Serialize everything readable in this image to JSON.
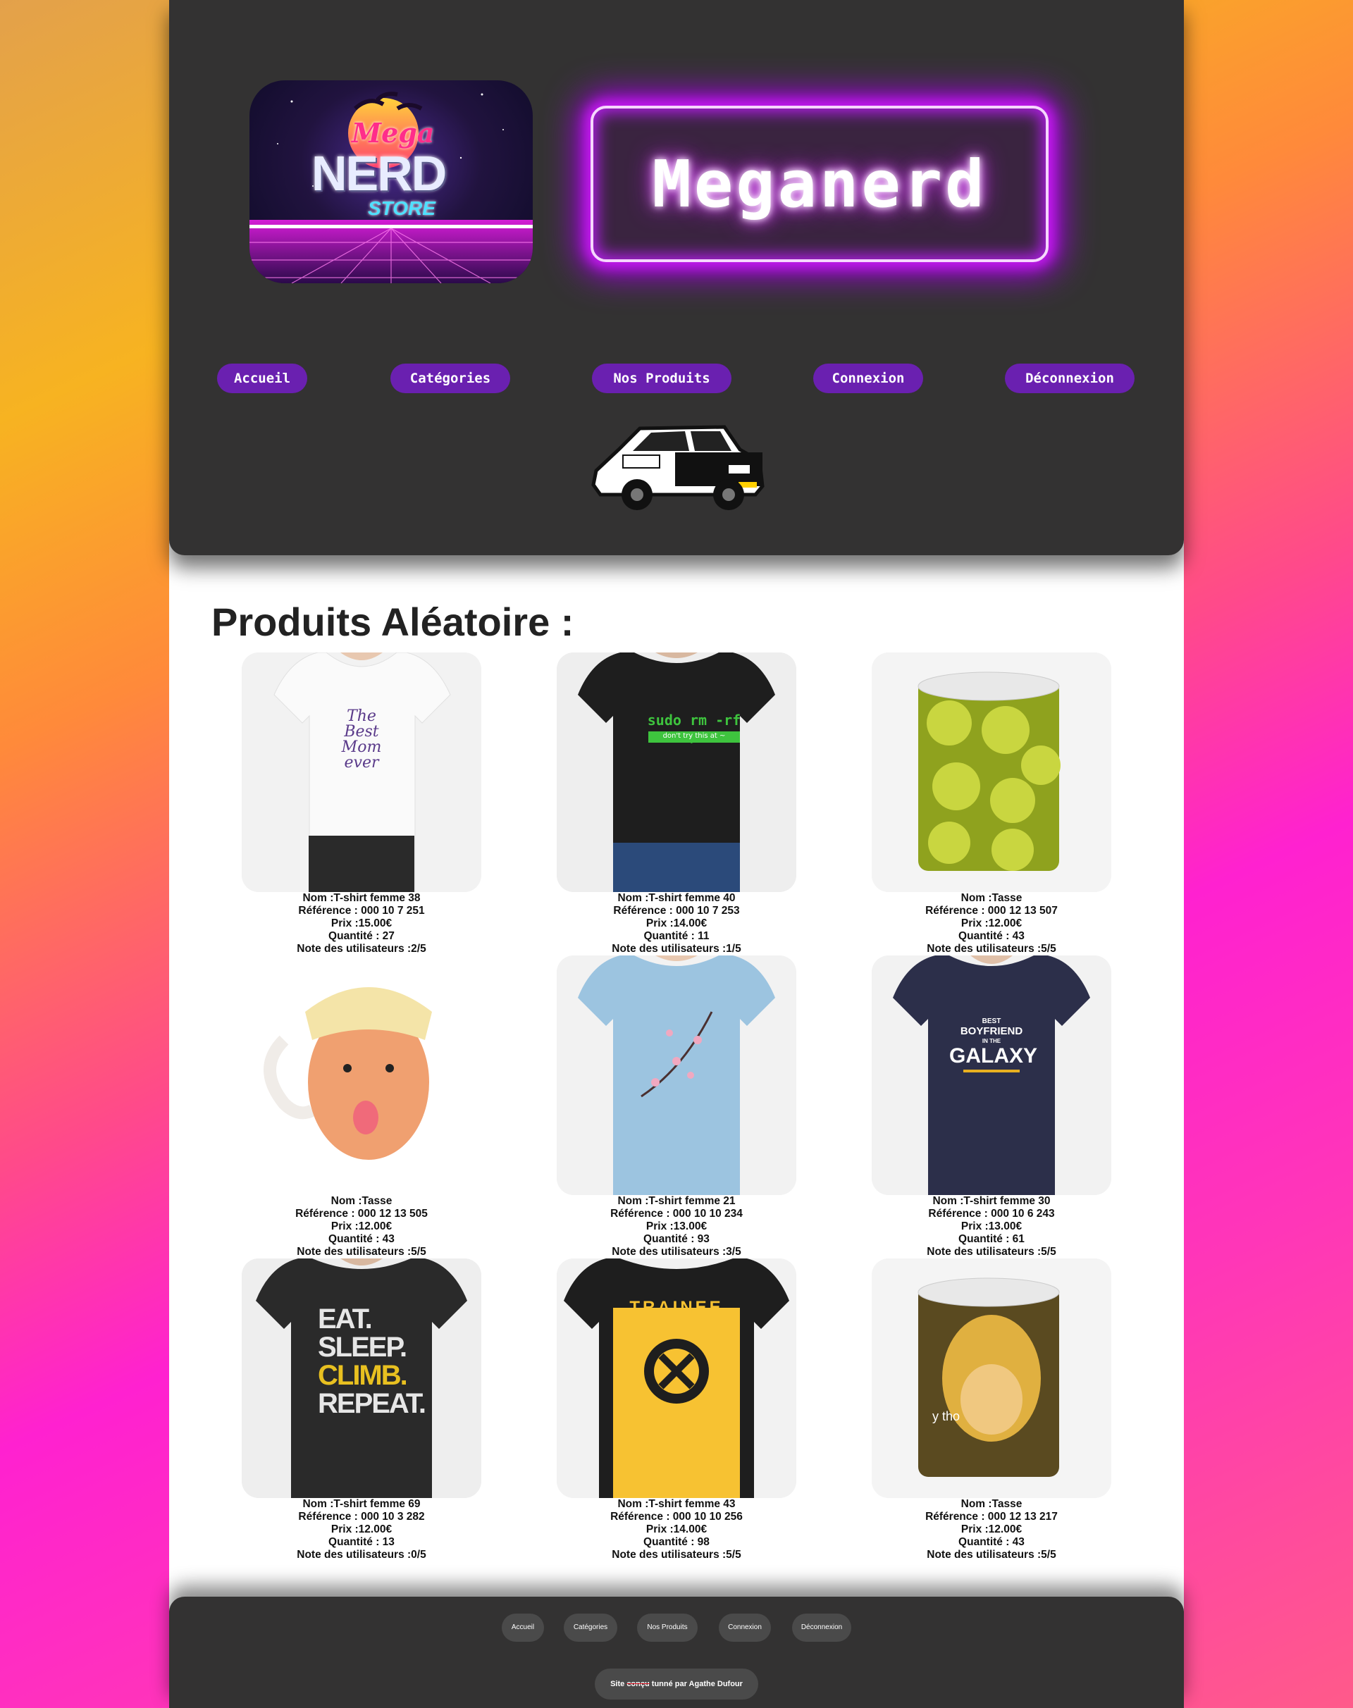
{
  "header": {
    "logo": {
      "line1": "Mega",
      "line2": "NERD",
      "line3": "STORE"
    },
    "brand": "Meganerd"
  },
  "nav": [
    "Accueil",
    "Catégories",
    "Nos Produits",
    "Connexion",
    "Déconnexion"
  ],
  "main": {
    "title": "Produits Aléatoire :",
    "products": [
      {
        "nom": "Nom :T-shirt femme 38",
        "ref": "Référence : 000 10 7 251",
        "prix": "Prix :15.00€",
        "qte": "Quantité : 27",
        "note": "Note des utilisateurs :2/5",
        "image": "white-tshirt-best-mom"
      },
      {
        "nom": "Nom :T-shirt femme 40",
        "ref": "Référence : 000 10 7 253",
        "prix": "Prix :14.00€",
        "qte": "Quantité : 11",
        "note": "Note des utilisateurs :1/5",
        "image": "black-tshirt-sudo",
        "print_main": "sudo rm -rf /",
        "print_sub": "don't try this at ~"
      },
      {
        "nom": "Nom :Tasse",
        "ref": "Référence : 000 12 13 507",
        "prix": "Prix :12.00€",
        "qte": "Quantité : 43",
        "note": "Note des utilisateurs :5/5",
        "image": "shrek-mug"
      },
      {
        "nom": "Nom :Tasse",
        "ref": "Référence : 000 12 13 505",
        "prix": "Prix :12.00€",
        "qte": "Quantité : 43",
        "note": "Note des utilisateurs :5/5",
        "image": "face-mug"
      },
      {
        "nom": "Nom :T-shirt femme 21",
        "ref": "Référence : 000 10 10 234",
        "prix": "Prix :13.00€",
        "qte": "Quantité : 93",
        "note": "Note des utilisateurs :3/5",
        "image": "blue-tshirt-blossom"
      },
      {
        "nom": "Nom :T-shirt femme 30",
        "ref": "Référence : 000 10 6 243",
        "prix": "Prix :13.00€",
        "qte": "Quantité : 61",
        "note": "Note des utilisateurs :5/5",
        "image": "navy-tshirt-galaxy",
        "print_top": "BEST",
        "print_mid": "BOYFRIEND",
        "print_in": "IN THE",
        "print_main": "GALAXY"
      },
      {
        "nom": "Nom :T-shirt femme 69",
        "ref": "Référence : 000 10 3 282",
        "prix": "Prix :12.00€",
        "qte": "Quantité : 13",
        "note": "Note des utilisateurs :0/5",
        "image": "black-tshirt-eat-sleep",
        "lines": [
          "EAT.",
          "SLEEP.",
          "CLIMB.",
          "REPEAT."
        ]
      },
      {
        "nom": "Nom :T-shirt femme 43",
        "ref": "Référence : 000 10 10 256",
        "prix": "Prix :14.00€",
        "qte": "Quantité : 98",
        "note": "Note des utilisateurs :5/5",
        "image": "yellow-tshirt-trainee",
        "print_main": "TRAINEE"
      },
      {
        "nom": "Nom :Tasse",
        "ref": "Référence : 000 12 13 217",
        "prix": "Prix :12.00€",
        "qte": "Quantité : 43",
        "note": "Note des utilisateurs :5/5",
        "image": "ytho-mug",
        "print_main": "y tho"
      }
    ]
  },
  "footer": {
    "nav": [
      "Accueil",
      "Catégories",
      "Nos Produits",
      "Connexion",
      "Déconnexion"
    ],
    "credit_prefix": "Site",
    "credit_struck": "conçu",
    "credit_suffix": "tunné par Agathe Dufour"
  }
}
